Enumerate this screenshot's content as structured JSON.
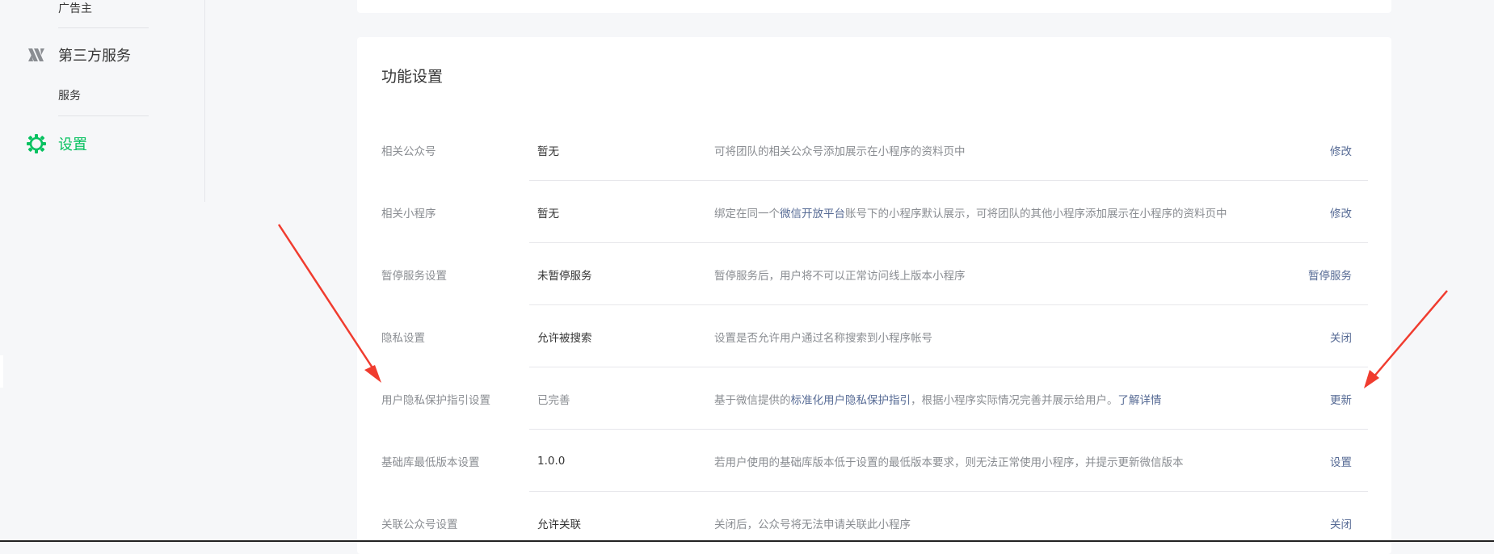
{
  "sidebar": {
    "items": [
      {
        "type": "sub",
        "label": "广告主"
      },
      {
        "type": "group",
        "label": "第三方服务",
        "icon": "third-party-icon"
      },
      {
        "type": "sub",
        "label": "服务"
      },
      {
        "type": "group",
        "label": "设置",
        "icon": "gear-icon",
        "active": true
      }
    ]
  },
  "main": {
    "section_title": "功能设置",
    "rows": [
      {
        "name": "相关公众号",
        "value": "暂无",
        "desc": "可将团队的相关公众号添加展示在小程序的资料页中",
        "action": "修改"
      },
      {
        "name": "相关小程序",
        "value": "暂无",
        "desc_pre": "绑定在同一个",
        "desc_link": "微信开放平台",
        "desc_post": "账号下的小程序默认展示，可将团队的其他小程序添加展示在小程序的资料页中",
        "action": "修改"
      },
      {
        "name": "暂停服务设置",
        "value": "未暂停服务",
        "desc": "暂停服务后，用户将不可以正常访问线上版本小程序",
        "action": "暂停服务"
      },
      {
        "name": "隐私设置",
        "value": "允许被搜索",
        "desc": "设置是否允许用户通过名称搜索到小程序帐号",
        "action": "关闭"
      },
      {
        "name": "用户隐私保护指引设置",
        "value": "已完善",
        "desc_pre": "基于微信提供的",
        "desc_link": "标准化用户隐私保护指引",
        "desc_post": "，根据小程序实际情况完善并展示给用户。",
        "desc_link2": "了解详情",
        "action": "更新"
      },
      {
        "name": "基础库最低版本设置",
        "value": "1.0.0",
        "desc": "若用户使用的基础库版本低于设置的最低版本要求，则无法正常使用小程序，并提示更新微信版本",
        "action": "设置"
      },
      {
        "name": "关联公众号设置",
        "value": "允许关联",
        "desc": "关闭后，公众号将无法申请关联此小程序",
        "action": "关闭"
      }
    ]
  },
  "colors": {
    "accent_green": "#07c160",
    "link_blue": "#576b95",
    "annotation_red": "#f03c2f"
  }
}
